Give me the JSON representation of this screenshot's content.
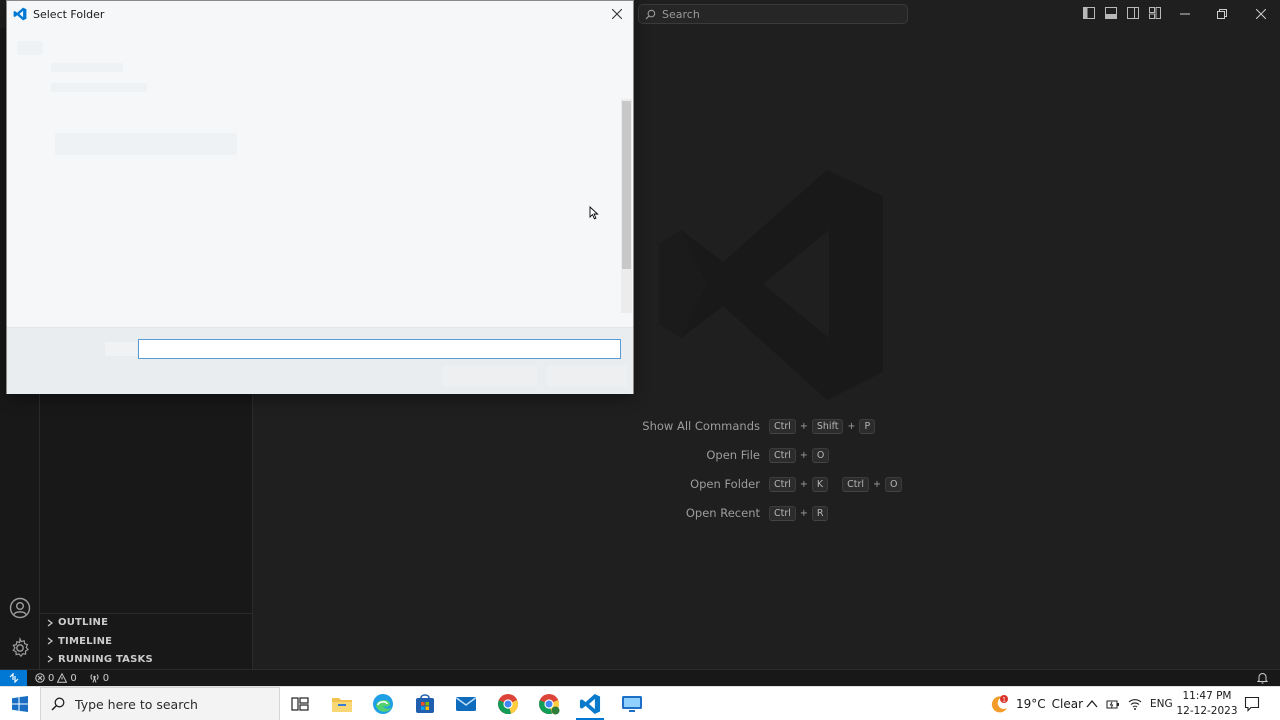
{
  "window": {
    "search_placeholder": "Search"
  },
  "sidebar": {
    "sections": [
      {
        "label": "OUTLINE"
      },
      {
        "label": "TIMELINE"
      },
      {
        "label": "RUNNING TASKS"
      }
    ]
  },
  "editor": {
    "shortcuts": [
      {
        "label": "Show All Commands",
        "keys": [
          "Ctrl",
          "+",
          "Shift",
          "+",
          "P"
        ]
      },
      {
        "label": "Open File",
        "keys": [
          "Ctrl",
          "+",
          "O"
        ]
      },
      {
        "label": "Open Folder",
        "keys": [
          "Ctrl",
          "+",
          "K",
          "|",
          "Ctrl",
          "+",
          "O"
        ]
      },
      {
        "label": "Open Recent",
        "keys": [
          "Ctrl",
          "+",
          "R"
        ]
      }
    ]
  },
  "statusbar": {
    "errors": "0",
    "warnings": "0",
    "ports": "0"
  },
  "dialog": {
    "title": "Select Folder",
    "input_value": ""
  },
  "taskbar": {
    "search_placeholder": "Type here to search",
    "apps": [
      "task-view",
      "file-explorer",
      "edge",
      "microsoft-store",
      "mail",
      "chrome",
      "chrome-profile",
      "vscode",
      "remote-desktop"
    ],
    "weather": {
      "temp": "19°C",
      "condition": "Clear"
    },
    "language": "ENG",
    "time": "11:47 PM",
    "date": "12-12-2023",
    "weather_badge": "1"
  },
  "colors": {
    "accent": "#0078d4",
    "editor_bg": "#1f1f1f",
    "dialog_bg": "#f5f7f8"
  }
}
